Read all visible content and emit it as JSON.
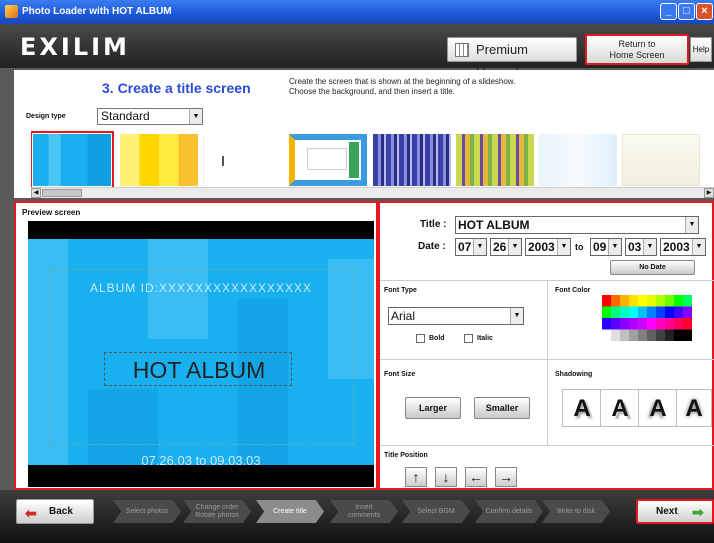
{
  "window": {
    "title": "Photo Loader with HOT ALBUM",
    "min": "_",
    "max": "□",
    "close": "×"
  },
  "header": {
    "logo": "EXILIM",
    "premium": "Premium Upgrade",
    "return_line1": "Return to",
    "return_line2": "Home Screen",
    "help": "Help"
  },
  "step": {
    "title": "3. Create a title screen",
    "instruction": "Create the screen that is shown at the beginning of a slideshow.\nChoose the background, and then insert a title."
  },
  "design": {
    "label": "Design type",
    "value": "Standard"
  },
  "preview": {
    "label": "Preview screen",
    "album_id": "ALBUM ID:XXXXXXXXXXXXXXXXX",
    "title": "HOT ALBUM",
    "date": "07.26.03 to 09.03.03"
  },
  "settings": {
    "title_label": "Title :",
    "title_value": "HOT ALBUM",
    "date_label": "Date :",
    "from": {
      "month": "07",
      "day": "26",
      "year": "2003"
    },
    "to_label": "to",
    "to": {
      "month": "09",
      "day": "03",
      "year": "2003"
    },
    "no_date": "No Date",
    "font_type_label": "Font Type",
    "font_value": "Arial",
    "bold": "Bold",
    "italic": "Italic",
    "font_color_label": "Font Color",
    "font_size_label": "Font Size",
    "larger": "Larger",
    "smaller": "Smaller",
    "shadowing_label": "Shadowing",
    "shadow_letter": "A",
    "title_position_label": "Title Position",
    "arrows": [
      "↑",
      "↓",
      "←",
      "→"
    ]
  },
  "nav": {
    "back": "Back",
    "next": "Next",
    "steps": [
      {
        "l1": "Select photos",
        "l2": ""
      },
      {
        "l1": "Change order",
        "l2": "Rotate photos"
      },
      {
        "l1": "Create title",
        "l2": ""
      },
      {
        "l1": "Insert",
        "l2": "comments"
      },
      {
        "l1": "Select BGM",
        "l2": ""
      },
      {
        "l1": "Confirm details",
        "l2": ""
      },
      {
        "l1": "Write to disk",
        "l2": ""
      }
    ]
  },
  "colors": {
    "accent_red": "#e5191d",
    "title_blue": "#2a4ad8",
    "preview_bg": "#19b0f0"
  }
}
